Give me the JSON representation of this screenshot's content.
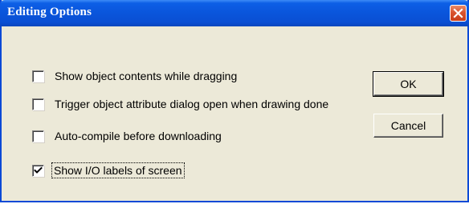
{
  "dialog": {
    "title": "Editing Options",
    "close_icon": "close-x-icon",
    "accent_color": "#0a55db",
    "close_color": "#d9532e"
  },
  "options": [
    {
      "label": "Show object contents while dragging",
      "checked": false
    },
    {
      "label": "Trigger object attribute dialog open when drawing done",
      "checked": false
    },
    {
      "label": "Auto-compile before downloading",
      "checked": false
    },
    {
      "label": "Show I/O labels of screen",
      "checked": true,
      "focused": true
    }
  ],
  "buttons": {
    "ok_label": "OK",
    "cancel_label": "Cancel"
  }
}
